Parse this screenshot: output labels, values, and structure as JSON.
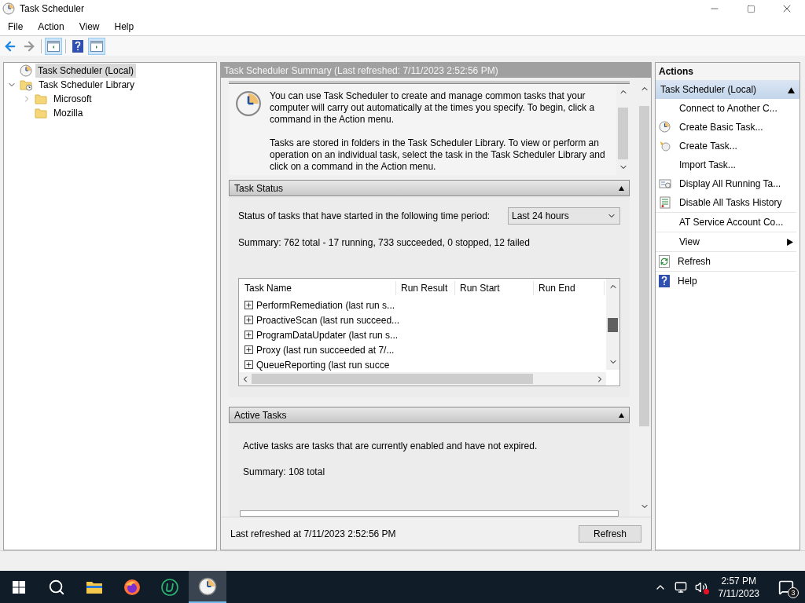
{
  "window": {
    "title": "Task Scheduler"
  },
  "menu": [
    "File",
    "Action",
    "View",
    "Help"
  ],
  "toolbar": [
    {
      "kind": "back",
      "disabled": false
    },
    {
      "kind": "forward",
      "disabled": true
    },
    {
      "kind": "console-tree",
      "pressed": true
    },
    {
      "kind": "help",
      "pressed": false
    },
    {
      "kind": "action-pane",
      "pressed": true
    }
  ],
  "tree": [
    {
      "label": "Task Scheduler (Local)",
      "kind": "scheduler",
      "selected": true,
      "expandable": false
    },
    {
      "label": "Task Scheduler Library",
      "kind": "library",
      "selected": false,
      "expandable": true,
      "expanded": true,
      "children": [
        {
          "label": "Microsoft",
          "kind": "folder",
          "selected": false,
          "expandable": true,
          "expanded": false
        },
        {
          "label": "Mozilla",
          "kind": "folder",
          "selected": false,
          "expandable": false
        }
      ]
    }
  ],
  "summary": {
    "title": "Task Scheduler Summary (Last refreshed: 7/11/2023 2:52:56 PM)",
    "intro": [
      "You can use Task Scheduler to create and manage common tasks that your computer will carry out automatically at the times you specify. To begin, click a command in the Action menu.",
      "Tasks are stored in folders in the Task Scheduler Library. To view or perform an operation on an individual task, select the task in the Task Scheduler Library and click on a command in the Action menu."
    ],
    "task_status": {
      "title": "Task Status",
      "expanded": true,
      "period_label": "Status of tasks that have started in the following time period:",
      "period": "Last 24 hours",
      "summary": "Summary: 762 total - 17 running, 733 succeeded, 0 stopped, 12 failed",
      "table": {
        "columns": [
          "Task Name",
          "Run Result",
          "Run Start",
          "Run End"
        ],
        "rows": [
          {
            "name": "PerformRemediation (last run s...",
            "expanded": false
          },
          {
            "name": "ProactiveScan (last run succeed...",
            "expanded": false
          },
          {
            "name": "ProgramDataUpdater (last run s...",
            "expanded": false
          },
          {
            "name": "Proxy (last run succeeded at 7/...",
            "expanded": false
          },
          {
            "name": "QueueReporting (last run succe",
            "expanded": false
          }
        ]
      }
    },
    "active_tasks": {
      "title": "Active Tasks",
      "expanded": true,
      "description": "Active tasks are tasks that are currently enabled and have not expired.",
      "summary": "Summary: 108 total"
    },
    "footer": "Last refreshed at 7/11/2023 2:52:56 PM",
    "refresh_button": "Refresh"
  },
  "actions": {
    "title": "Actions",
    "group": "Task Scheduler (Local)",
    "group_expanded": true,
    "items": [
      {
        "label": "Connect to Another C...",
        "kind": "plain",
        "separator_after": false
      },
      {
        "label": "Create Basic Task...",
        "kind": "basic-task",
        "separator_after": false
      },
      {
        "label": "Create Task...",
        "kind": "task",
        "separator_after": false
      },
      {
        "label": "Import Task...",
        "kind": "plain",
        "separator_after": false
      },
      {
        "label": "Display All Running Ta...",
        "kind": "running",
        "separator_after": false
      },
      {
        "label": "Disable All Tasks History",
        "kind": "history",
        "separator_after": true
      },
      {
        "label": "AT Service Account Co...",
        "kind": "plain",
        "separator_after": true
      },
      {
        "label": "View",
        "kind": "submenu",
        "separator_after": true
      },
      {
        "label": "Refresh",
        "kind": "refresh",
        "separator_after": true
      },
      {
        "label": "Help",
        "kind": "help",
        "separator_after": false
      }
    ]
  },
  "taskbar": {
    "apps": [
      {
        "kind": "search",
        "active": false
      },
      {
        "kind": "explorer",
        "active": false
      },
      {
        "kind": "firefox",
        "active": false
      },
      {
        "kind": "u-app",
        "active": false
      },
      {
        "kind": "clock",
        "active": true
      }
    ],
    "time": "2:57 PM",
    "date": "7/11/2023",
    "notifications": "3"
  }
}
